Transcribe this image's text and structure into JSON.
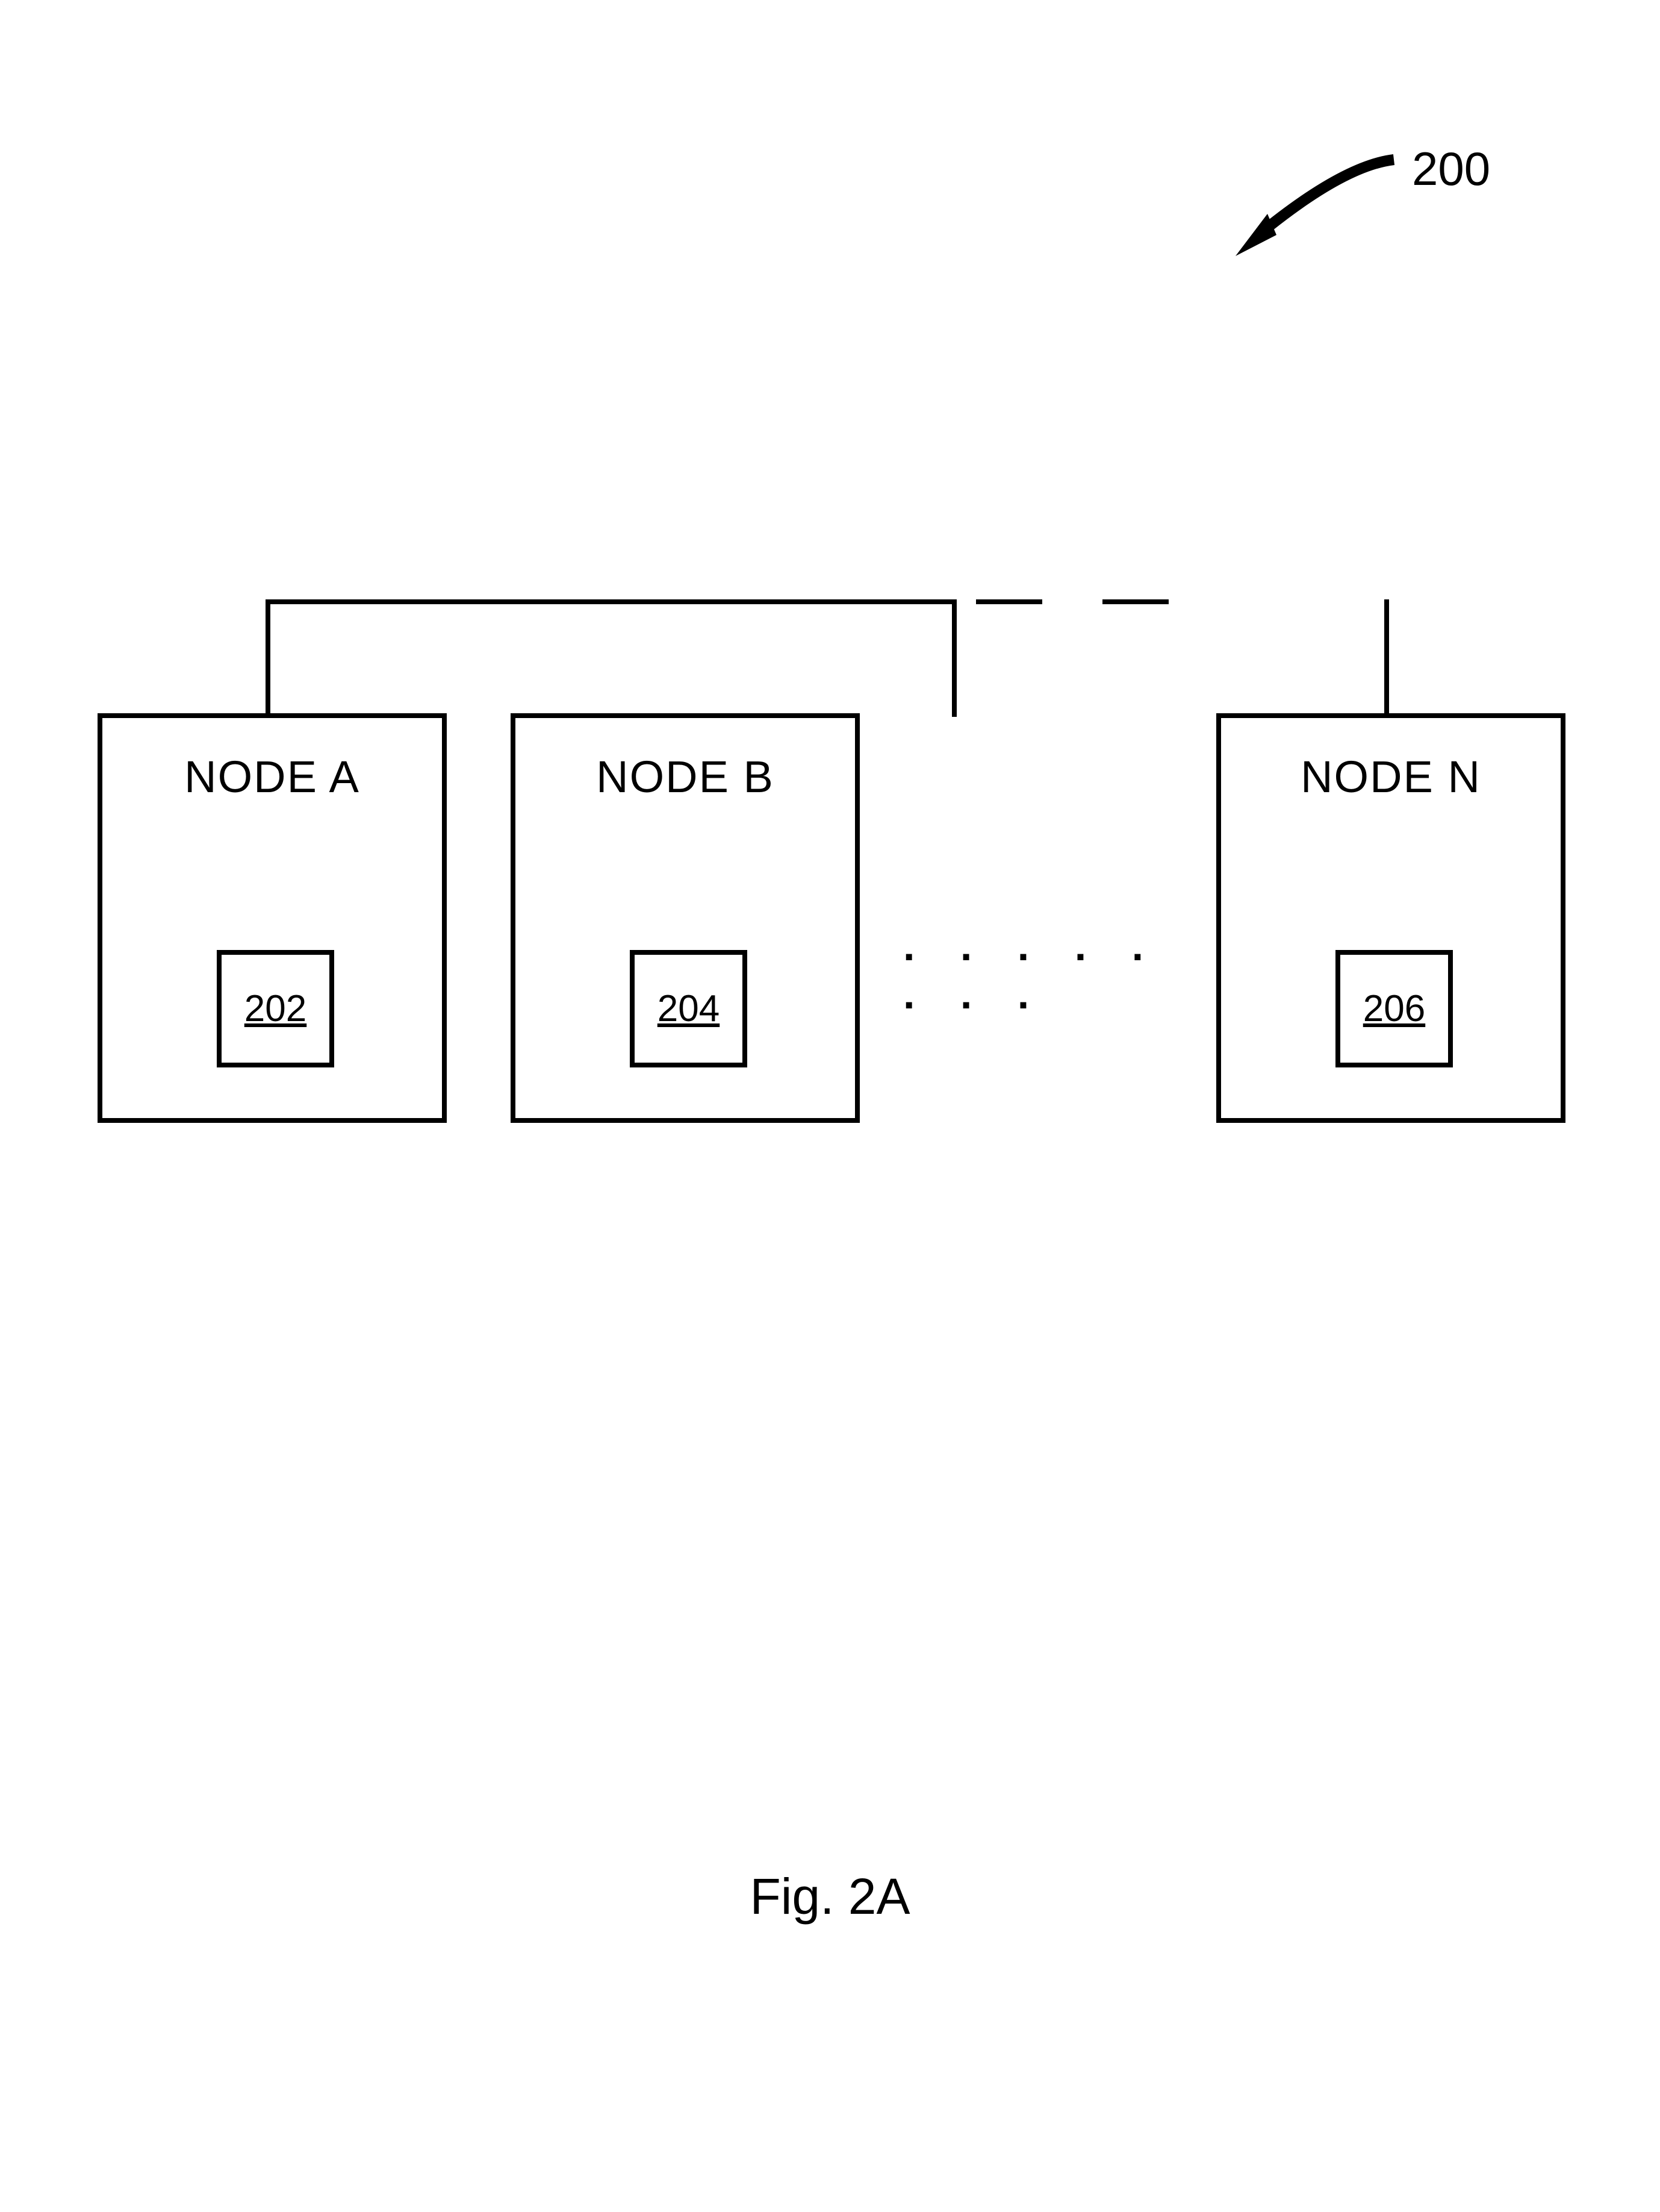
{
  "figure": {
    "reference": "200",
    "caption": "Fig. 2A",
    "ellipsis": ". . . . . . . ."
  },
  "nodes": {
    "a": {
      "title": "NODE A",
      "inner": "202"
    },
    "b": {
      "title": "NODE B",
      "inner": "204"
    },
    "n": {
      "title": "NODE N",
      "inner": "206"
    }
  }
}
